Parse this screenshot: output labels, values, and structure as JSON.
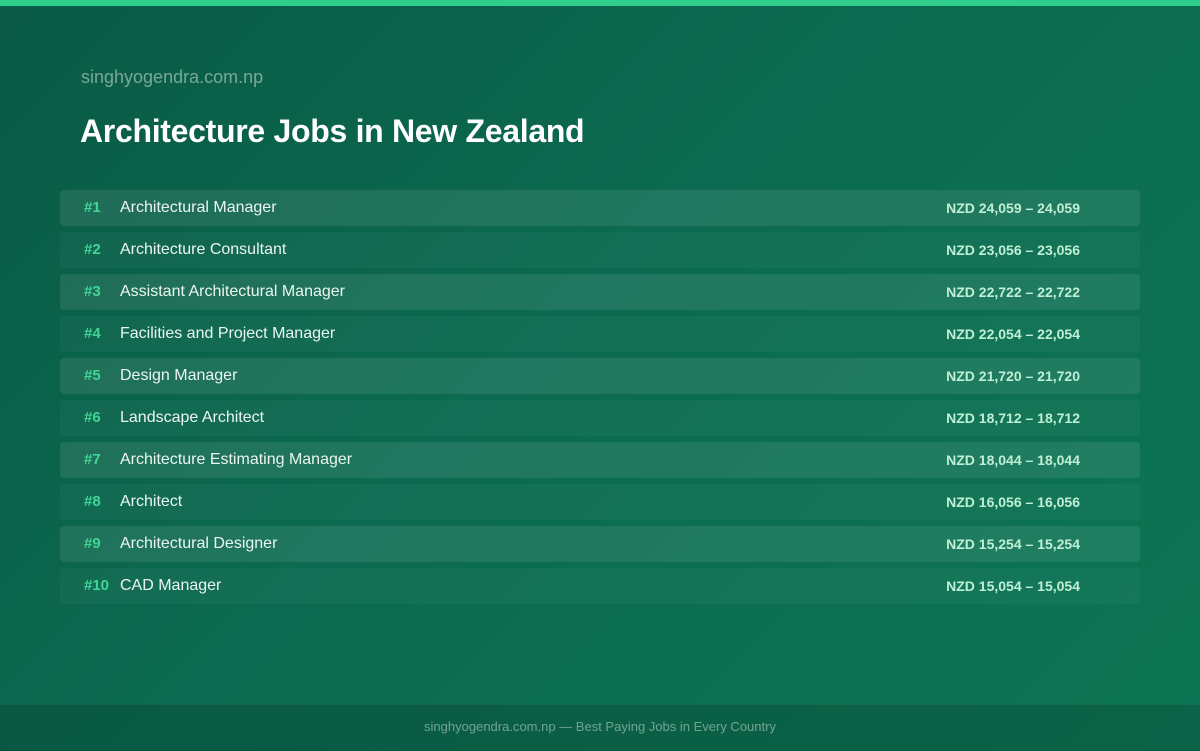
{
  "header": {
    "site": "singhyogendra.com.np",
    "title": "Architecture Jobs in New Zealand"
  },
  "jobs": [
    {
      "rank": "#1",
      "title": "Architectural Manager",
      "salary": "NZD 24,059 – 24,059"
    },
    {
      "rank": "#2",
      "title": "Architecture Consultant",
      "salary": "NZD 23,056 – 23,056"
    },
    {
      "rank": "#3",
      "title": "Assistant Architectural Manager",
      "salary": "NZD 22,722 – 22,722"
    },
    {
      "rank": "#4",
      "title": "Facilities and Project Manager",
      "salary": "NZD 22,054 – 22,054"
    },
    {
      "rank": "#5",
      "title": "Design Manager",
      "salary": "NZD 21,720 – 21,720"
    },
    {
      "rank": "#6",
      "title": "Landscape Architect",
      "salary": "NZD 18,712 – 18,712"
    },
    {
      "rank": "#7",
      "title": "Architecture Estimating Manager",
      "salary": "NZD 18,044 – 18,044"
    },
    {
      "rank": "#8",
      "title": "Architect",
      "salary": "NZD 16,056 – 16,056"
    },
    {
      "rank": "#9",
      "title": "Architectural Designer",
      "salary": "NZD 15,254 – 15,254"
    },
    {
      "rank": "#10",
      "title": "CAD Manager",
      "salary": "NZD 15,054 – 15,054"
    }
  ],
  "footer": {
    "text": "singhyogendra.com.np — Best Paying Jobs in Every Country"
  },
  "colors": {
    "accent": "#2fcf8b",
    "rank": "#3fd695",
    "salary": "#bff0d6",
    "background": "#0b6a4f"
  }
}
